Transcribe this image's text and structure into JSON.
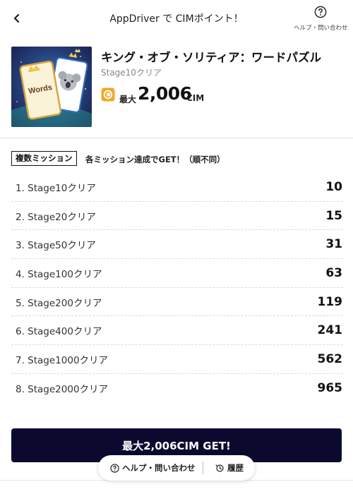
{
  "header": {
    "title": "AppDriver で CIMポイント！",
    "help_label": "ヘルプ・問い合わせ",
    "back_icon": "chevron-left-icon",
    "help_icon": "question-circle-icon"
  },
  "app": {
    "name": "キング・オブ・ソリティア：ワードパズル",
    "subtitle": "Stage10クリア",
    "thumb_card_text": "Words",
    "max_prefix": "最大",
    "max_value": "2,006",
    "max_unit": "CIM",
    "coin_icon": "cim-coin-icon"
  },
  "missions": {
    "tag": "複数ミッション",
    "note": "各ミッション達成でGET！（順不同）",
    "items": [
      {
        "label": "1. Stage10クリア",
        "points": "10"
      },
      {
        "label": "2. Stage20クリア",
        "points": "15"
      },
      {
        "label": "3. Stage50クリア",
        "points": "31"
      },
      {
        "label": "4. Stage100クリア",
        "points": "63"
      },
      {
        "label": "5. Stage200クリア",
        "points": "119"
      },
      {
        "label": "6. Stage400クリア",
        "points": "241"
      },
      {
        "label": "7. Stage1000クリア",
        "points": "562"
      },
      {
        "label": "8. Stage2000クリア",
        "points": "965"
      }
    ]
  },
  "cta": {
    "label": "最大2,006CIM GET!"
  },
  "footer_pill": {
    "help_label": "ヘルプ・問い合わせ",
    "history_label": "履歴",
    "help_icon": "question-circle-icon",
    "history_icon": "history-icon"
  },
  "colors": {
    "cta_background": "#0b0a2e",
    "coin_orange": "#f5a623"
  }
}
